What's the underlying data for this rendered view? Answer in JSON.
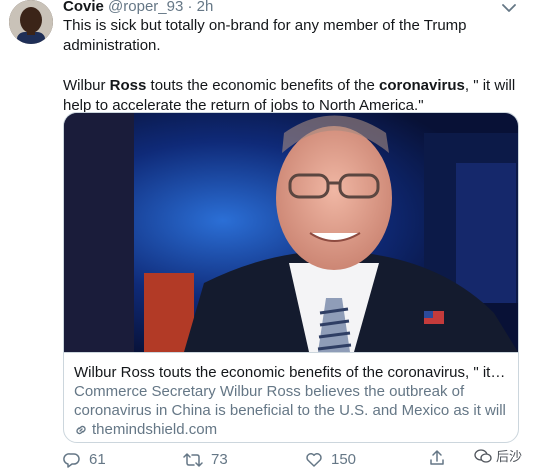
{
  "tweet": {
    "author_name": "Covie",
    "author_handle": "@roper_93",
    "separator": "·",
    "time": "2h",
    "text_line1": "This is sick but totally on-brand for any member of the Trump administration.",
    "quote": {
      "part1": "Wilbur ",
      "bold1": "Ross",
      "part2": " touts the economic benefits of the ",
      "bold2": "coronavirus",
      "part3": ", \" it will help to accelerate the return of jobs to North America.\""
    },
    "icons": {
      "more": "chevron-down-icon",
      "link": "link-icon",
      "reply": "reply-icon",
      "retweet": "retweet-icon",
      "like": "heart-icon",
      "share": "share-icon"
    }
  },
  "card": {
    "title": "Wilbur Ross touts the economic benefits of the coronavirus, \" it wi...",
    "description": "Commerce Secretary Wilbur Ross believes the outbreak of coronavirus in China is beneficial to the U.S. and Mexico as it will ...",
    "domain": "themindshield.com"
  },
  "actions": {
    "reply_count": "61",
    "retweet_count": "73",
    "like_count": "150"
  },
  "watermark": {
    "label": "后沙"
  },
  "colors": {
    "text_primary": "#14171a",
    "text_secondary": "#657786",
    "border": "#ccd6dd"
  }
}
